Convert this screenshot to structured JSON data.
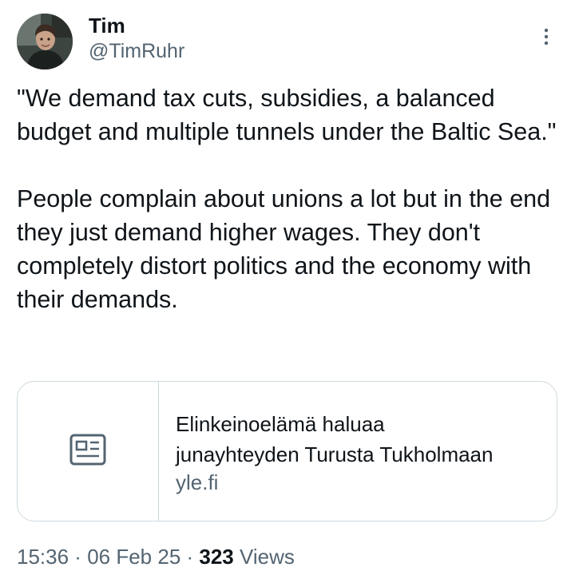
{
  "author": {
    "display_name": "Tim",
    "handle": "@TimRuhr"
  },
  "tweet": {
    "text": "\"We demand tax cuts, subsidies, a balanced budget and multiple tunnels under the Baltic Sea.\"\n\nPeople complain about unions a lot but in the end they just demand higher wages. They don't completely distort politics and the economy with their demands."
  },
  "link_card": {
    "title": "Elinkeinoelämä haluaa\njunayhteyden Turusta Tukholmaan",
    "domain": "yle.fi",
    "icon": "article-icon"
  },
  "meta": {
    "time": "15:36",
    "separator_1": " · ",
    "date": "06 Feb 25",
    "separator_2": " · ",
    "views_count": "323",
    "views_label": " Views"
  },
  "colors": {
    "text_primary": "#0f1419",
    "text_secondary": "#536471",
    "border": "#cfd9de",
    "background": "#ffffff"
  },
  "icons": {
    "more": "more-vertical-icon",
    "card": "article-icon"
  }
}
